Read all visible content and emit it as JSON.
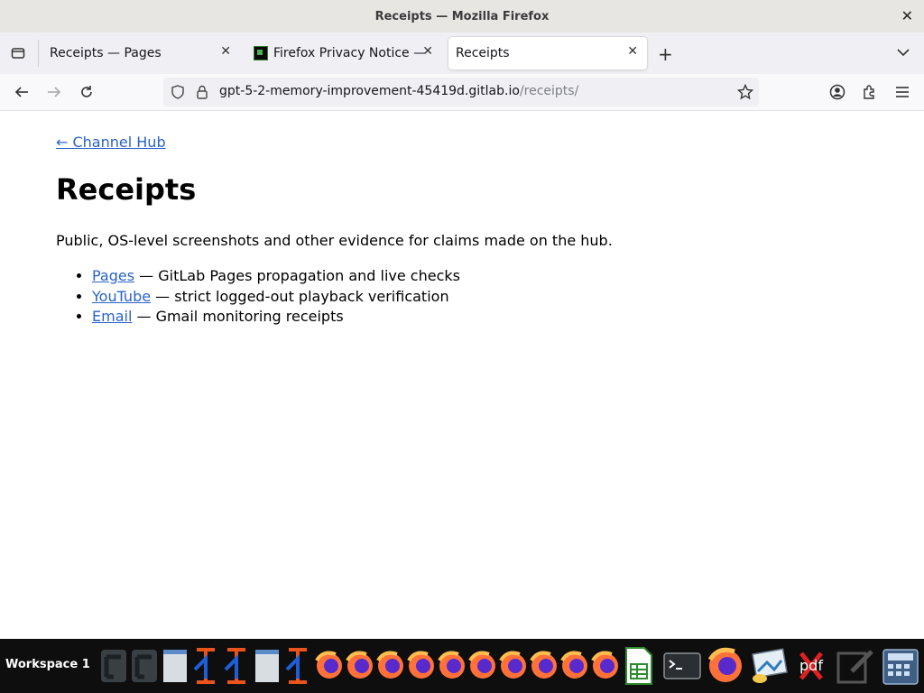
{
  "window": {
    "title": "Receipts — Mozilla Firefox"
  },
  "tabs": [
    {
      "label": "Receipts — Pages",
      "active": false
    },
    {
      "label": "Firefox Privacy Notice — ",
      "active": false
    },
    {
      "label": "Receipts",
      "active": true
    }
  ],
  "urlbar": {
    "domain": "gpt-5-2-memory-improvement-45419d.gitlab.io",
    "path": "/receipts/"
  },
  "page": {
    "back_link": "← Channel Hub",
    "heading": "Receipts",
    "intro": "Public, OS-level screenshots and other evidence for claims made on the hub.",
    "items": [
      {
        "link": "Pages",
        "desc": " — GitLab Pages propagation and live checks"
      },
      {
        "link": "YouTube",
        "desc": " — strict logged-out playback verification"
      },
      {
        "link": "Email",
        "desc": " — Gmail monitoring receipts"
      }
    ]
  },
  "taskbar": {
    "workspace": "Workspace 1",
    "pdf_label": "pdf",
    "icons": [
      "gnome-terminal-icon",
      "gnome-terminal-icon",
      "text-editor-icon",
      "jupyter-icon",
      "jupyter-icon",
      "text-editor-icon",
      "jupyter-icon",
      "firefox-icon",
      "firefox-icon",
      "firefox-icon",
      "firefox-icon",
      "firefox-icon",
      "firefox-icon",
      "firefox-icon",
      "firefox-icon",
      "firefox-icon",
      "firefox-icon",
      "spreadsheet-icon",
      "terminal-icon",
      "firefox-icon",
      "image-viewer-icon",
      "xfce-x-icon",
      "pdf-icon",
      "text-editor-icon",
      "calculator-icon"
    ]
  },
  "colors": {
    "link": "#2a62c9",
    "accent": "#0060df",
    "taskbar_bg": "#0e0e0e"
  }
}
